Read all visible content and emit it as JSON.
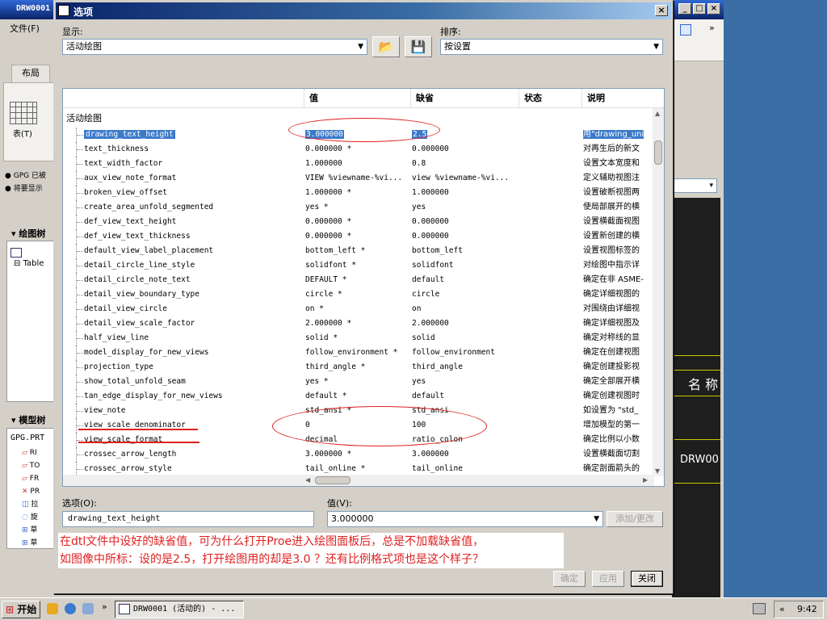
{
  "bg_window": {
    "title": "DRW0001",
    "menu_file": "文件(F)",
    "tab_layout": "布局",
    "table_label": "表(T)",
    "bullet1": "GPG 已被",
    "bullet2": "将要显示",
    "tree_title": "绘图树",
    "tree_item": "Table",
    "model_title": "模型树",
    "model_root": "GPG.PRT",
    "model_items": [
      "RI",
      "TO",
      "FR",
      "PR",
      "拉",
      "旋",
      "草",
      "草"
    ],
    "name_text": "名 称",
    "drw_text": "DRW00"
  },
  "dialog": {
    "title": "选项",
    "show_label": "显示:",
    "show_value": "活动绘图",
    "sort_label": "排序:",
    "sort_value": "按设置",
    "columns": {
      "name": "",
      "value": "值",
      "default": "缺省",
      "status": "状态",
      "desc": "说明"
    },
    "group": "活动绘图",
    "rows": [
      {
        "name": "drawing_text_height",
        "value": "3.000000",
        "default": "2.5",
        "desc": "用\"drawing_uni",
        "selected": true
      },
      {
        "name": "text_thickness",
        "value": "0.000000 *",
        "default": "0.000000",
        "desc": "对再生后的新文"
      },
      {
        "name": "text_width_factor",
        "value": "1.000000",
        "default": "0.8",
        "desc": "设置文本宽度和"
      },
      {
        "name": "aux_view_note_format",
        "value": "VIEW %viewname-%vi...",
        "default": "view %viewname-%vi...",
        "desc": "定义辅助视图注"
      },
      {
        "name": "broken_view_offset",
        "value": "1.000000 *",
        "default": "1.000000",
        "desc": "设置破断视图两"
      },
      {
        "name": "create_area_unfold_segmented",
        "value": "yes *",
        "default": "yes",
        "desc": "使局部展开的横"
      },
      {
        "name": "def_view_text_height",
        "value": "0.000000 *",
        "default": "0.000000",
        "desc": "设置横截面视图"
      },
      {
        "name": "def_view_text_thickness",
        "value": "0.000000 *",
        "default": "0.000000",
        "desc": "设置新创建的横"
      },
      {
        "name": "default_view_label_placement",
        "value": "bottom_left *",
        "default": "bottom_left",
        "desc": "设置视图标签的"
      },
      {
        "name": "detail_circle_line_style",
        "value": "solidfont *",
        "default": "solidfont",
        "desc": "对绘图中指示详"
      },
      {
        "name": "detail_circle_note_text",
        "value": "DEFAULT *",
        "default": "default",
        "desc": "确定在非 ASME-"
      },
      {
        "name": "detail_view_boundary_type",
        "value": "circle *",
        "default": "circle",
        "desc": "确定详细视图的"
      },
      {
        "name": "detail_view_circle",
        "value": "on *",
        "default": "on",
        "desc": "对围绕由详细视"
      },
      {
        "name": "detail_view_scale_factor",
        "value": "2.000000 *",
        "default": "2.000000",
        "desc": "确定详细视图及"
      },
      {
        "name": "half_view_line",
        "value": "solid *",
        "default": "solid",
        "desc": "确定对称线的显"
      },
      {
        "name": "model_display_for_new_views",
        "value": "follow_environment *",
        "default": "follow_environment",
        "desc": "确定在创建视图"
      },
      {
        "name": "projection_type",
        "value": "third_angle *",
        "default": "third_angle",
        "desc": "确定创建投影视"
      },
      {
        "name": "show_total_unfold_seam",
        "value": "yes *",
        "default": "yes",
        "desc": "确定全部展开横"
      },
      {
        "name": "tan_edge_display_for_new_views",
        "value": "default *",
        "default": "default",
        "desc": "确定创建视图时"
      },
      {
        "name": "view_note",
        "value": "std_ansi *",
        "default": "std_ansi",
        "desc": "如设置为 \"std_"
      },
      {
        "name": "view_scale_denominator",
        "value": "0",
        "default": "100",
        "desc": "增加模型的第一"
      },
      {
        "name": "view_scale_format",
        "value": "decimal",
        "default": "ratio_colon",
        "desc": "确定比例以小数"
      },
      {
        "name": "crossec_arrow_length",
        "value": "3.000000 *",
        "default": "3.000000",
        "desc": "设置横截面切割"
      },
      {
        "name": "crossec_arrow_style",
        "value": "tail_online *",
        "default": "tail_online",
        "desc": "确定剖面箭头的"
      }
    ],
    "option_label": "选项(O):",
    "option_value": "drawing_text_height",
    "value_label": "值(V):",
    "value_value": "3.000000",
    "add_change": "添加/更改",
    "ok": "确定",
    "apply": "应用",
    "close": "关闭",
    "question_line1": "在dtl文件中设好的缺省值，可为什么打开Proe进入绘图面板后，总是不加载缺省值，",
    "question_line2": "如图像中所标：设的是2.5，打开绘图用的却是3.0 ？还有比例格式项也是这个样子？"
  },
  "taskbar": {
    "start": "开始",
    "task": "DRW0001 (活动的) - ...",
    "time": "9:42"
  },
  "colors": {
    "status_dot": "#1d9c3f",
    "annotation": "#e02020",
    "selection": "#3b7acb"
  }
}
